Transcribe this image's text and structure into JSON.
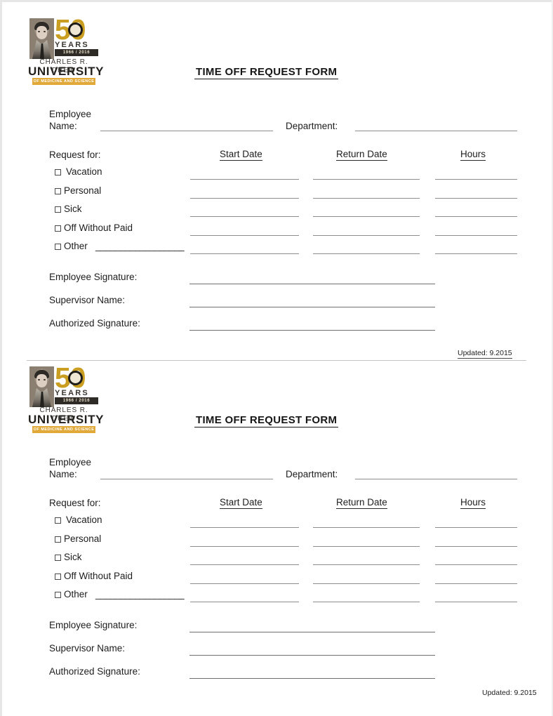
{
  "document": {
    "title": "TIME OFF REQUEST FORM",
    "copies": 2
  },
  "logo": {
    "anniversary_number": "50",
    "years_word": "YEARS",
    "year_range": "1966  /  2016",
    "name_line1": "CHARLES R. DREW",
    "name_line2": "UNIVERSITY",
    "tagline": "OF MEDICINE AND SCIENCE",
    "gold": "#c6960f",
    "banner_gold": "#e0a93a",
    "ink": "#23211e"
  },
  "fields": {
    "employee_name": "Employee\nName:",
    "department": "Department:",
    "request_for": "Request for:"
  },
  "columns": [
    {
      "label": "Start Date"
    },
    {
      "label": "Return Date"
    },
    {
      "label": "Hours"
    }
  ],
  "request_types": [
    {
      "label": "Vacation",
      "has_fill_line": false,
      "fill": ""
    },
    {
      "label": "Personal",
      "has_fill_line": false,
      "fill": ""
    },
    {
      "label": "Sick",
      "has_fill_line": false,
      "fill": ""
    },
    {
      "label": "Off Without Paid",
      "has_fill_line": false,
      "fill": ""
    },
    {
      "label": "Other",
      "has_fill_line": true,
      "fill": "__________________"
    }
  ],
  "signatures": [
    {
      "label": "Employee Signature:"
    },
    {
      "label": "Supervisor Name:"
    },
    {
      "label": "Authorized Signature:"
    }
  ],
  "footer": {
    "updated_top": "Updated: 9.2015",
    "updated_bottom": "Updated:  9.2015"
  }
}
